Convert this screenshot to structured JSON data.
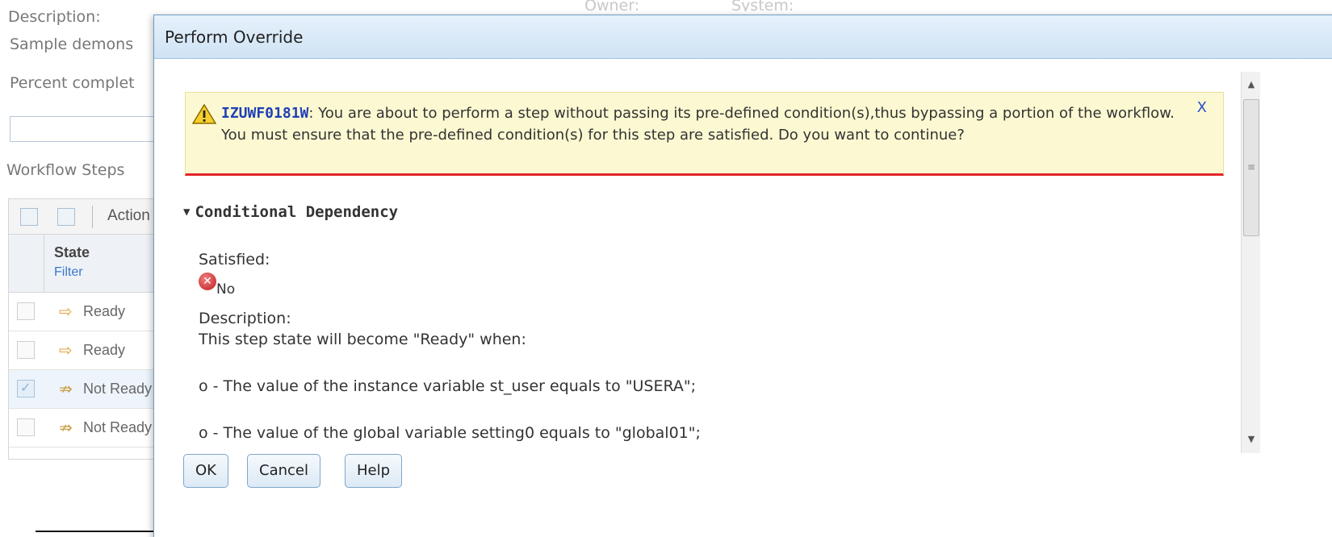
{
  "background": {
    "description_label": "Description:",
    "description_value": "Sample demons",
    "percent_label": "Percent complet",
    "steps_label": "Workflow Steps",
    "owner_label": "Owner:",
    "system_label": "System:",
    "toolbar_actions": "Action",
    "grid_header_state": "State",
    "grid_header_filter": "Filter",
    "rows": [
      {
        "state": "Ready",
        "checked": false
      },
      {
        "state": "Ready",
        "checked": false
      },
      {
        "state": "Not Ready",
        "checked": true
      },
      {
        "state": "Not Ready",
        "checked": false
      }
    ]
  },
  "dialog": {
    "title": "Perform Override",
    "warning": {
      "code": "IZUWF0181W",
      "message": ": You are about to perform a step without passing its pre-defined condition(s),thus bypassing a portion of the workflow. You must ensure that the pre-defined condition(s) for this step are satisfied. Do you want to continue?",
      "close_label": "X"
    },
    "section_title": "Conditional Dependency",
    "satisfied_label": "Satisfied:",
    "satisfied_value": "No",
    "description_label": "Description:",
    "description_lines": [
      "This step state will become \"Ready\" when:",
      "o - The value of the instance variable st_user equals to \"USERA\";",
      "o - The value of the global variable setting0 equals to \"global01\";"
    ],
    "buttons": {
      "ok": "OK",
      "cancel": "Cancel",
      "help": "Help"
    }
  },
  "colors": {
    "title_bar": "#cfe3f5",
    "warning_bg": "#fcf9d2",
    "warning_rule": "#e32626",
    "message_code": "#1f3fb6",
    "button_border": "#7fa6c9"
  }
}
